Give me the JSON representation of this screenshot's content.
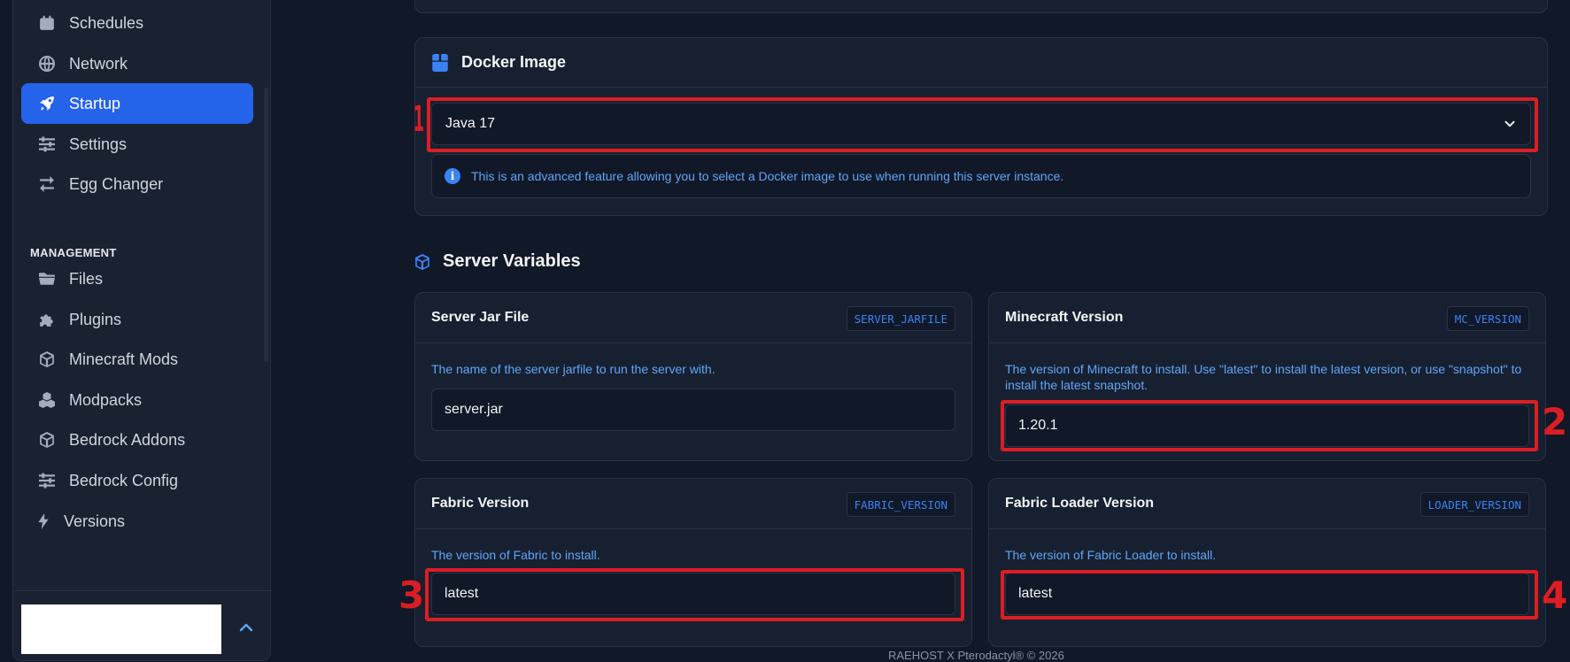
{
  "sidebar": {
    "items": [
      {
        "label": "Schedules",
        "icon": "calendar-icon"
      },
      {
        "label": "Network",
        "icon": "globe-icon"
      },
      {
        "label": "Startup",
        "icon": "rocket-icon",
        "active": true
      },
      {
        "label": "Settings",
        "icon": "sliders-icon"
      },
      {
        "label": "Egg Changer",
        "icon": "swap-icon"
      }
    ],
    "section_label": "MANAGEMENT",
    "management_items": [
      {
        "label": "Files",
        "icon": "folder-icon"
      },
      {
        "label": "Plugins",
        "icon": "puzzle-icon"
      },
      {
        "label": "Minecraft Mods",
        "icon": "cube-icon"
      },
      {
        "label": "Modpacks",
        "icon": "cubes-icon"
      },
      {
        "label": "Bedrock Addons",
        "icon": "cube-icon"
      },
      {
        "label": "Bedrock Config",
        "icon": "sliders-icon"
      },
      {
        "label": "Versions",
        "icon": "bolt-icon"
      }
    ]
  },
  "docker": {
    "title": "Docker Image",
    "selected": "Java 17",
    "info": "This is an advanced feature allowing you to select a Docker image to use when running this server instance."
  },
  "server_variables": {
    "title": "Server Variables",
    "vars": [
      {
        "name": "Server Jar File",
        "code": "SERVER_JARFILE",
        "description": "The name of the server jarfile to run the server with.",
        "value": "server.jar"
      },
      {
        "name": "Minecraft Version",
        "code": "MC_VERSION",
        "description": "The version of Minecraft to install. Use \"latest\" to install the latest version, or use \"snapshot\" to install the latest snapshot.",
        "value": "1.20.1"
      },
      {
        "name": "Fabric Version",
        "code": "FABRIC_VERSION",
        "description": "The version of Fabric to install.",
        "value": "latest"
      },
      {
        "name": "Fabric Loader Version",
        "code": "LOADER_VERSION",
        "description": "The version of Fabric Loader to install.",
        "value": "latest"
      }
    ]
  },
  "annotations": [
    "1",
    "2",
    "3",
    "4"
  ],
  "footer": "RAEHOST X Pterodactyl® © 2026",
  "colors": {
    "accent": "#2563eb",
    "annotation": "#dc1e24",
    "info_text": "#60a5fa"
  }
}
